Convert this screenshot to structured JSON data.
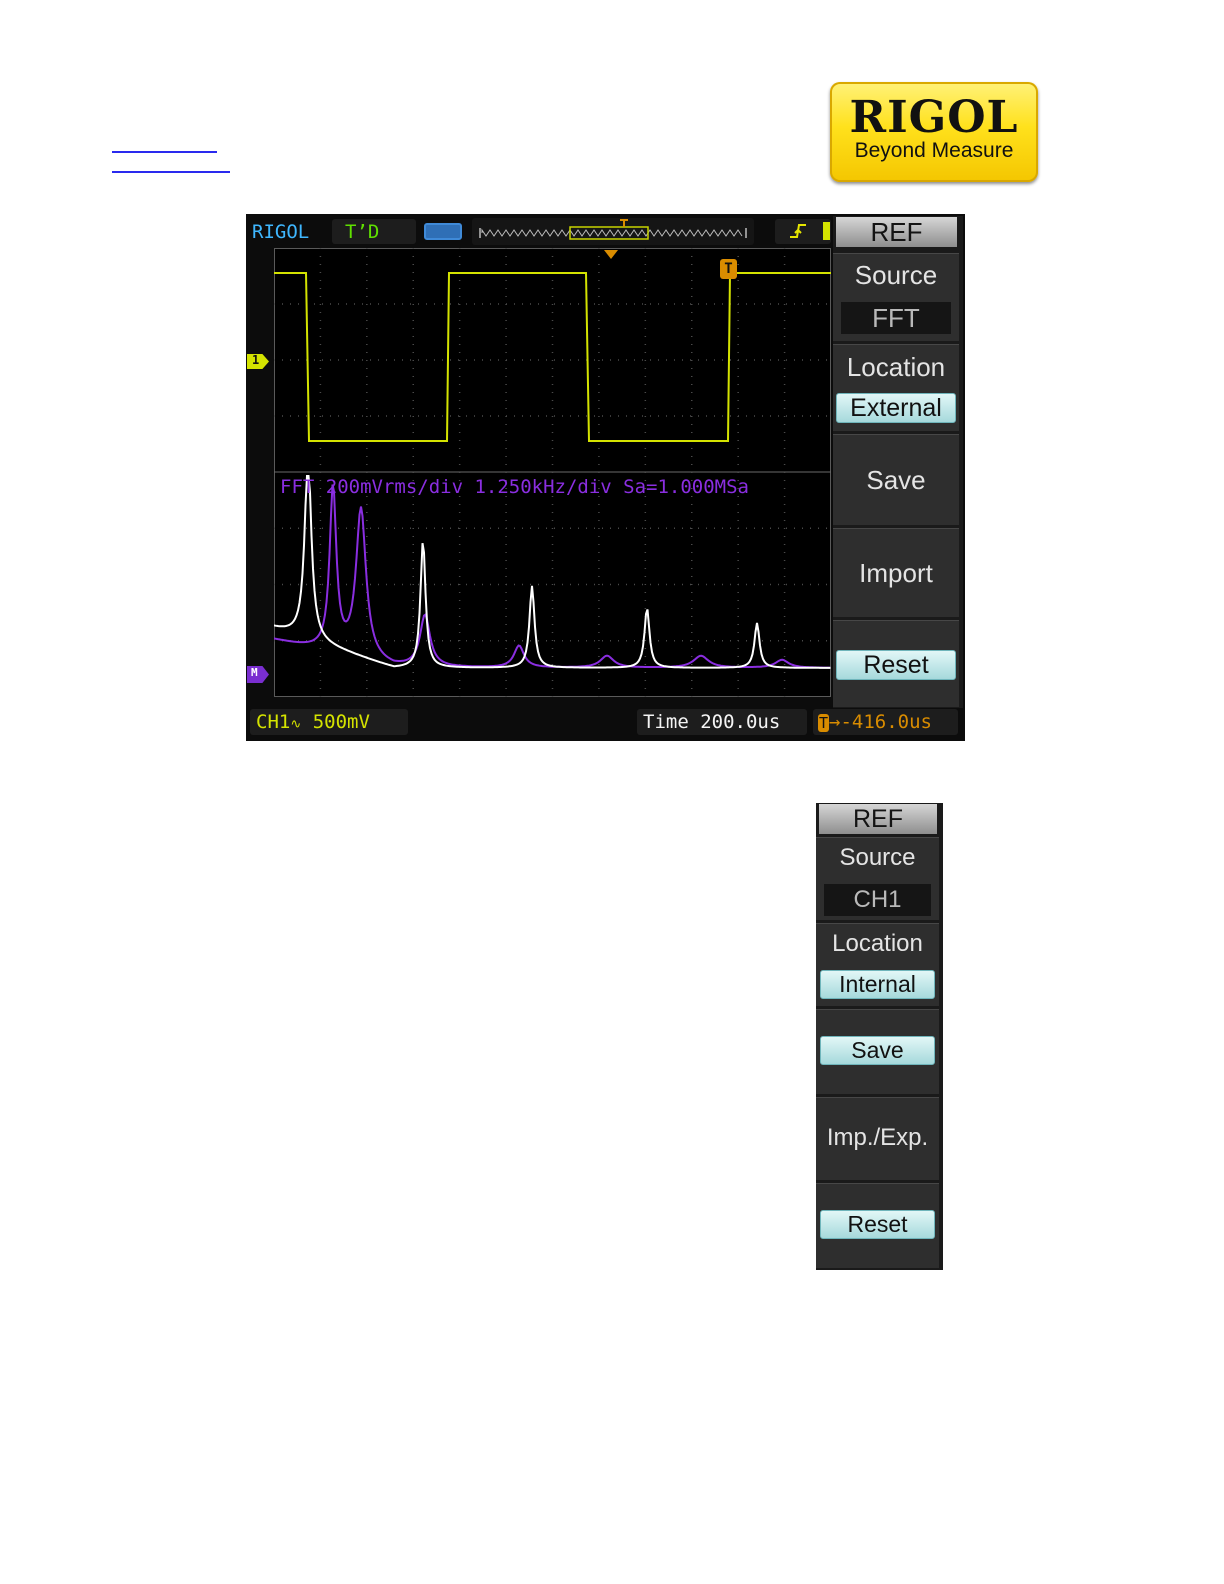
{
  "logo": {
    "brand": "RIGOL",
    "tagline": "Beyond Measure"
  },
  "scope": {
    "status_bar": {
      "brand": "RIGOL",
      "run_state": "T’D",
      "trigger_edge_icon": "rising-edge-icon"
    },
    "fft_label": "FFT  200mVrms/div 1.250kHz/div Sa=1.000MSa",
    "ch1_marker": "1",
    "math_marker": "M",
    "bottom_bar": {
      "channel": "CH1",
      "coupling": "∿",
      "scale": "500mV",
      "timebase": "Time 200.0us",
      "trigger_pos_icon": "T",
      "trigger_offset": "→-416.0us"
    },
    "colors": {
      "ch1": "#d4e300",
      "fft_ref": "#ffffff",
      "fft_live": "#8a2ee0",
      "accent": "#d98c00"
    },
    "menu": {
      "title": "REF",
      "source_label": "Source",
      "source_value": "FFT",
      "location_label": "Location",
      "location_value": "External",
      "save": "Save",
      "import": "Import",
      "reset": "Reset"
    }
  },
  "menu2": {
    "title": "REF",
    "source_label": "Source",
    "source_value": "CH1",
    "location_label": "Location",
    "location_value": "Internal",
    "save": "Save",
    "imp_exp": "Imp./Exp.",
    "reset": "Reset"
  }
}
